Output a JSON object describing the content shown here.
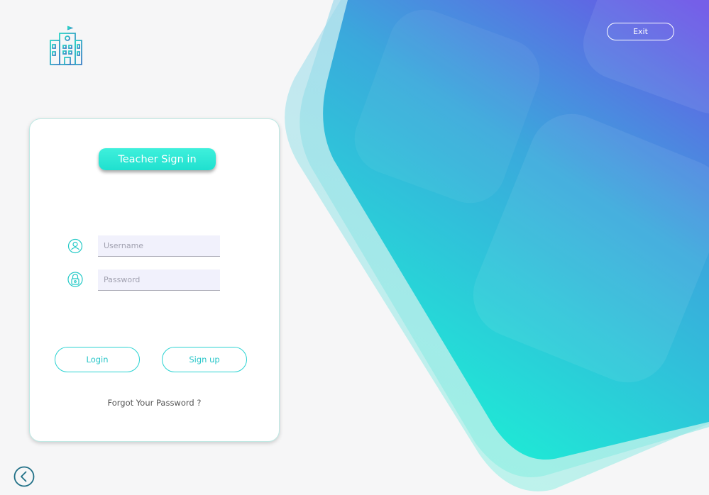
{
  "window": {
    "exit_label": "Exit"
  },
  "login_card": {
    "title": "Teacher Sign in",
    "username_placeholder": "Username",
    "password_placeholder": "Password",
    "login_label": "Login",
    "signup_label": "Sign up",
    "forgot_label": "Forgot Your Password ?"
  },
  "icons": {
    "logo": "school-building-icon",
    "username": "user-icon",
    "password": "lock-icon",
    "back": "chevron-left-circle-icon"
  },
  "colors": {
    "accent": "#2bd3d2",
    "accent_fill": "#1fe0cf",
    "gradient_top": "#6a52e6",
    "gradient_mid": "#31b8d8",
    "gradient_bottom": "#1ee6d5",
    "background": "#f6f6f7"
  }
}
